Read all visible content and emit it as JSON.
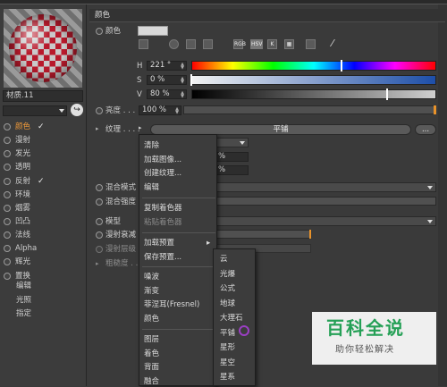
{
  "material": {
    "name": "材质.11"
  },
  "channels": [
    {
      "label": "颜色",
      "checked": true,
      "active": true
    },
    {
      "label": "漫射",
      "checked": false
    },
    {
      "label": "发光",
      "checked": false
    },
    {
      "label": "透明",
      "checked": false
    },
    {
      "label": "反射",
      "checked": true
    },
    {
      "label": "环境",
      "checked": false
    },
    {
      "label": "烟雾",
      "checked": false
    },
    {
      "label": "凹凸",
      "checked": false
    },
    {
      "label": "法线",
      "checked": false
    },
    {
      "label": "Alpha",
      "checked": false
    },
    {
      "label": "辉光",
      "checked": false
    },
    {
      "label": "置换",
      "checked": false
    }
  ],
  "channel_check_glyph": "✓",
  "extra_items": [
    "编辑",
    "光照",
    "指定"
  ],
  "section_title": "颜色",
  "color_label": "颜色",
  "hsv": {
    "h_label": "H",
    "h_value": "221 °",
    "h_fraction": 0.614,
    "s_label": "S",
    "s_value": "0 %",
    "v_label": "V",
    "v_value": "80 %",
    "v_fraction": 0.8
  },
  "brightness": {
    "label": "亮度 . . .",
    "value": "100 %"
  },
  "texture": {
    "label": "纹理 . . . .",
    "button": "平铺",
    "more": "..."
  },
  "mix_mode_label": "混合模式",
  "mix_strength_label": "混合强度",
  "model_label": "模型",
  "diffuse_falloff_label": "漫射衰减",
  "diffuse_level_label": "漫射层级",
  "roughness_label": "粗糙度 . .",
  "texture_menu": [
    {
      "label": "清除"
    },
    {
      "label": "加载图像..."
    },
    {
      "label": "创建纹理..."
    },
    {
      "label": "编辑"
    },
    {
      "label": "复制着色器"
    },
    {
      "label": "粘贴着色器",
      "disabled": true
    },
    {
      "label": "加载预置",
      "submenu": true
    },
    {
      "label": "保存预置..."
    },
    {
      "label": "噪波"
    },
    {
      "label": "渐变"
    },
    {
      "label": "菲涅耳(Fresnel)"
    },
    {
      "label": "颜色"
    },
    {
      "label": "图层"
    },
    {
      "label": "着色"
    },
    {
      "label": "背面"
    },
    {
      "label": "融合"
    }
  ],
  "submenu_arrow": "▸",
  "preset_menu": [
    "云",
    "光爆",
    "公式",
    "地球",
    "大理石",
    "平铺",
    "星形",
    "星空",
    "星系"
  ],
  "watermark": {
    "line1": "百科全说",
    "line2": "助你轻松解决"
  },
  "partial_values": {
    "p1": "%",
    "p2": "%"
  },
  "icons": {
    "spectrum": "RGB",
    "hsv": "HSV",
    "kelvin": "K",
    "mix": "▦",
    "picker": "pipette-icon"
  }
}
